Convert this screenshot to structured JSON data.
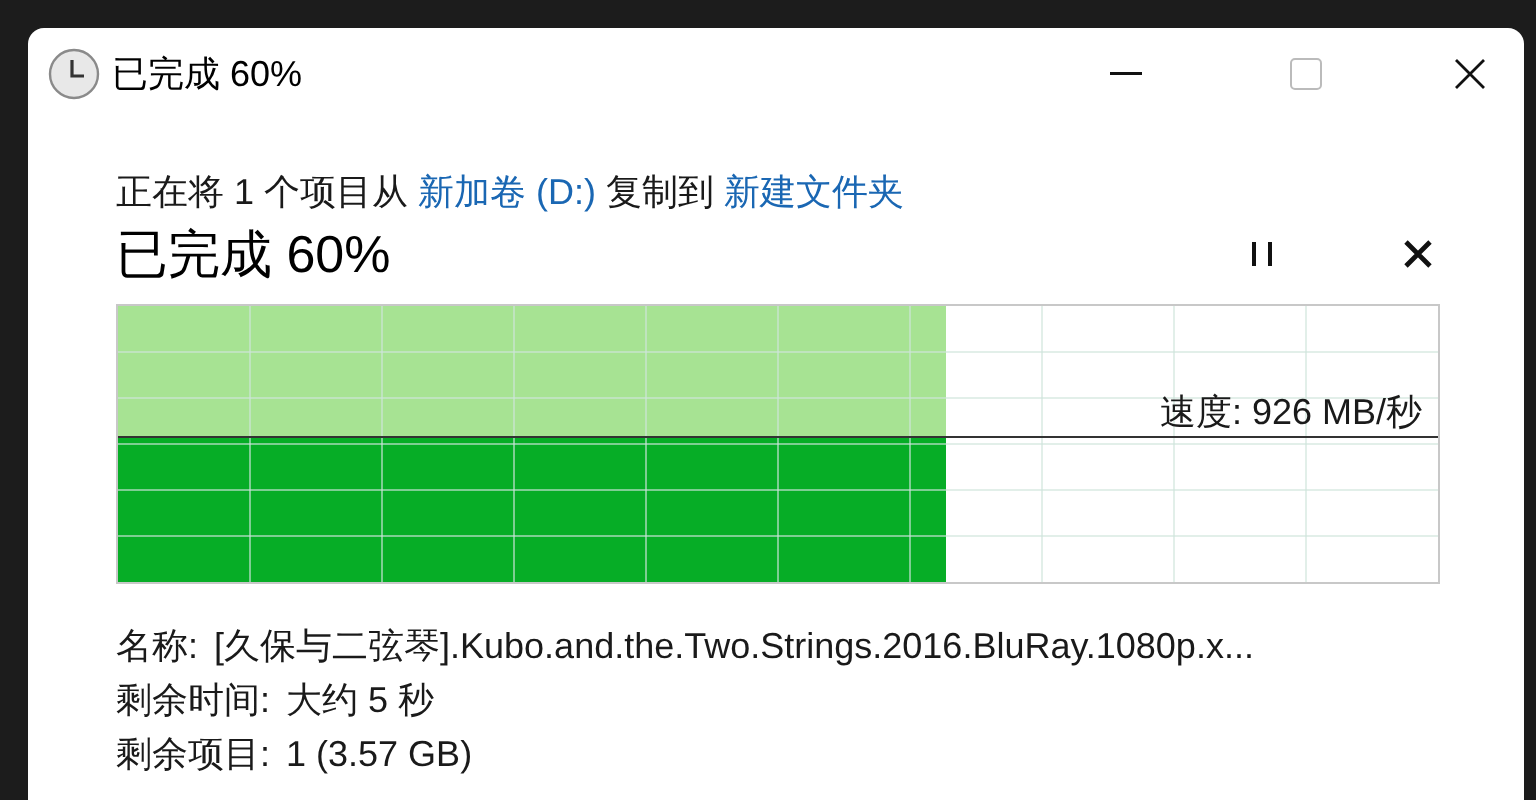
{
  "window": {
    "title": "已完成 60%"
  },
  "message": {
    "parts": [
      {
        "kind": "text",
        "text": "正在将 1 个项目从"
      },
      {
        "kind": "link",
        "text": "新加卷 (D:)"
      },
      {
        "kind": "text",
        "text": "复制到"
      },
      {
        "kind": "link",
        "text": "新建文件夹"
      }
    ]
  },
  "heading": "已完成 60%",
  "progress": {
    "level": 0.627,
    "reading": "速度: 926 MB/秒"
  },
  "details": [
    {
      "label": "名称:",
      "value": "[久保与二弦琴].Kubo.and.the.Two.Strings.2016.BluRay.1080p.x..."
    },
    {
      "label": "剩余时间:",
      "value": "大约 5 秒"
    },
    {
      "label": "剩余项目:",
      "value": "1 (3.57 GB)"
    }
  ]
}
